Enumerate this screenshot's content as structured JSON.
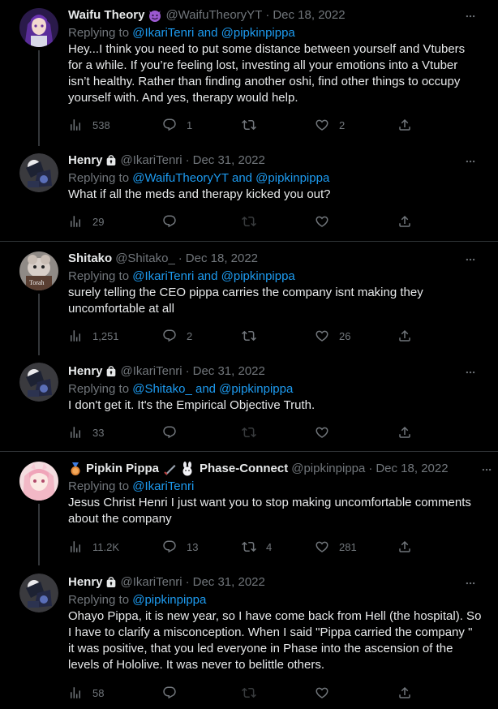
{
  "tweets": [
    {
      "name": "Waifu Theory",
      "handle": "@WaifuTheoryYT",
      "date": "Dec 18, 2022",
      "replying_prefix": "Replying to ",
      "replying_to": "@IkariTenri and @pipkinpippa",
      "text": "Hey...I think you need to put some distance between yourself and Vtubers for a while. If you’re feeling lost, investing all your emotions into a Vtuber isn’t healthy. Rather than finding another oshi, find other things to occupy yourself with. And yes, therapy would help.",
      "views": "538",
      "replies": "1",
      "retweets": "",
      "likes": "2"
    },
    {
      "name": "Henry",
      "handle": "@IkariTenri",
      "date": "Dec 31, 2022",
      "replying_prefix": "Replying to ",
      "replying_to": "@WaifuTheoryYT and @pipkinpippa",
      "text": "What if all the meds and therapy kicked you out?",
      "views": "29",
      "replies": "",
      "retweets": "",
      "likes": ""
    },
    {
      "name": "Shitako",
      "handle": "@Shitako_",
      "date": "Dec 18, 2022",
      "replying_prefix": "Replying to ",
      "replying_to": "@IkariTenri and @pipkinpippa",
      "text": "surely telling the CEO pippa carries the company isnt making they uncomfortable at all",
      "views": "1,251",
      "replies": "2",
      "retweets": "",
      "likes": "26",
      "avatar_label": "Torah"
    },
    {
      "name": "Henry",
      "handle": "@IkariTenri",
      "date": "Dec 31, 2022",
      "replying_prefix": "Replying to ",
      "replying_to": "@Shitako_ and @pipkinpippa",
      "text": "I don't get it. It's the Empirical Objective Truth.",
      "views": "33",
      "replies": "",
      "retweets": "",
      "likes": ""
    },
    {
      "name": "Pipkin Pippa",
      "name_suffix": "Phase-Connect",
      "handle": "@pipkinpippa",
      "date": "Dec 18, 2022",
      "replying_prefix": "Replying to ",
      "replying_to": "@IkariTenri",
      "text": "Jesus Christ Henri I just want you to stop making uncomfortable comments about the company",
      "views": "11.2K",
      "replies": "13",
      "retweets": "4",
      "likes": "281"
    },
    {
      "name": "Henry",
      "handle": "@IkariTenri",
      "date": "Dec 31, 2022",
      "replying_prefix": "Replying to ",
      "replying_to": "@pipkinpippa",
      "text": "Ohayo Pippa, it is new year, so I have come back from Hell (the hospital). So I have to clarify a misconception. When I said \"Pippa carried the company \" it was positive, that you led everyone in Phase into the ascension of the levels of Hololive. It was never to belittle others.",
      "views": "58",
      "replies": "",
      "retweets": "",
      "likes": ""
    }
  ],
  "colors": {
    "background": "#000000",
    "text": "#e7e9ea",
    "muted": "#71767b",
    "link": "#1d9bf0",
    "divider": "#2f3336"
  },
  "icons": [
    "views-icon",
    "reply-icon",
    "retweet-icon",
    "like-icon",
    "share-icon",
    "more-icon",
    "lock-icon",
    "devil-emoji-icon",
    "medal-emoji-icon",
    "sword-emoji-icon",
    "rabbit-emoji-icon"
  ]
}
